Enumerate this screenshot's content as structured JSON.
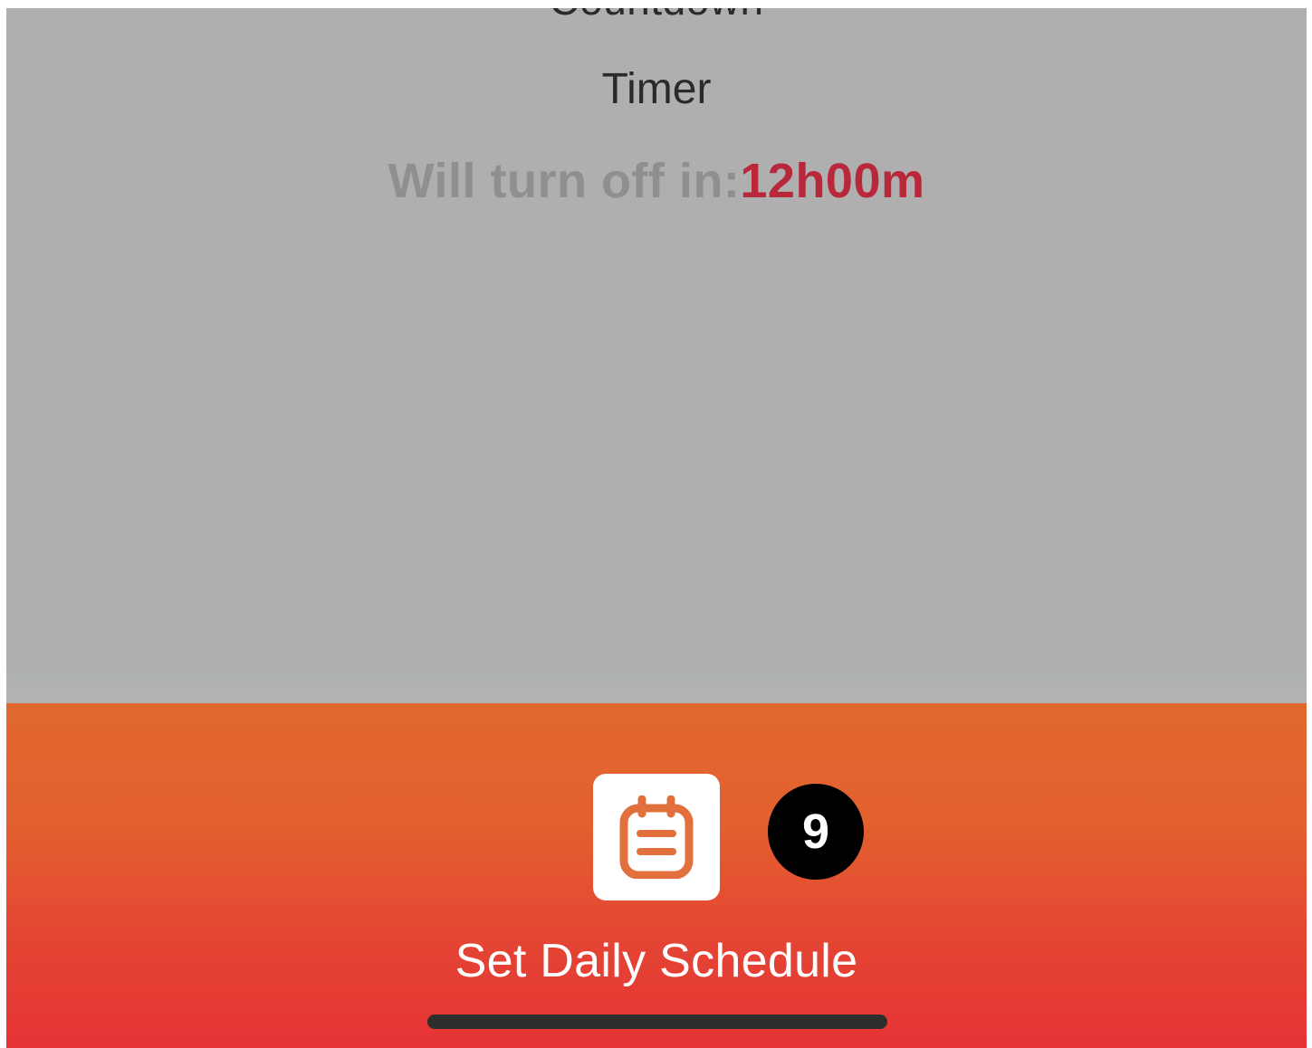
{
  "timer": {
    "countdown_label": "Countdown",
    "timer_label": "Timer",
    "turn_off_prefix": "Will turn off in:",
    "turn_off_time": "12h00m"
  },
  "bottom_bar": {
    "button_icon": "clipboard-icon",
    "button_label": "Set Daily Schedule"
  },
  "annotation": {
    "step_number": "9"
  },
  "colors": {
    "panel_gray": "#afafaf",
    "time_red": "#b8283a",
    "bar_top": "#e1692e",
    "bar_bottom": "#e63336",
    "icon_orange": "#e2703c"
  }
}
